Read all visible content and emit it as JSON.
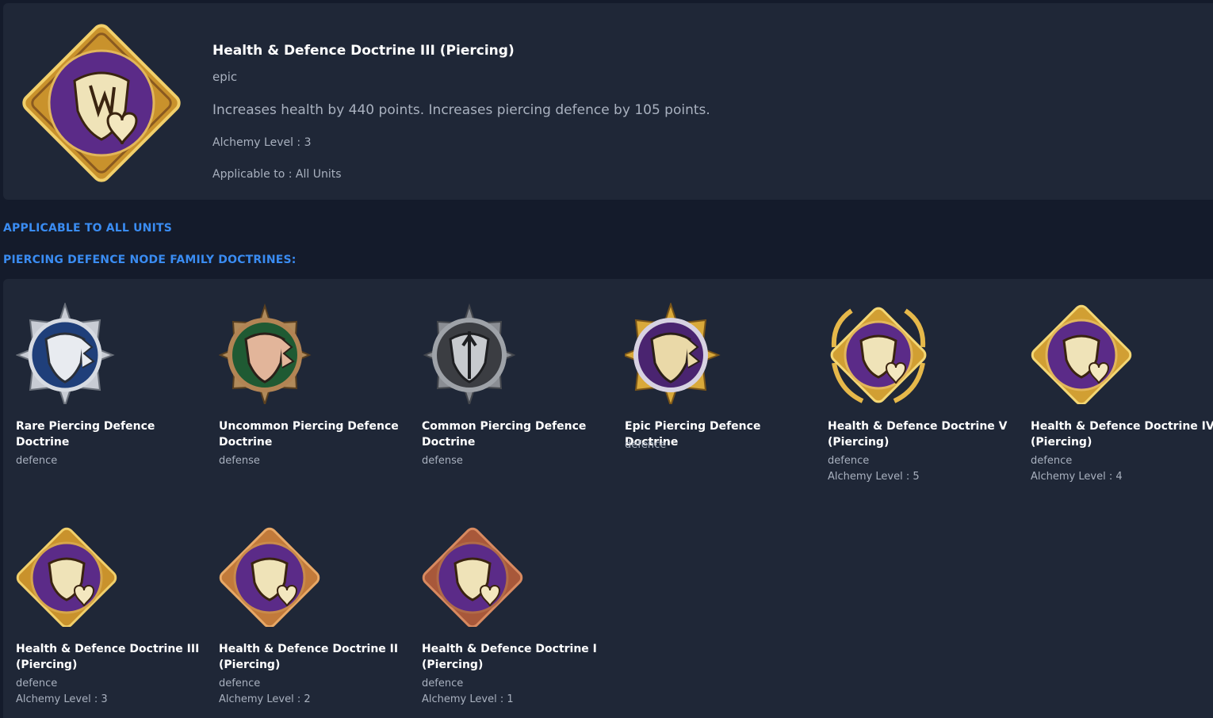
{
  "selected": {
    "title": "Health & Defence Doctrine III (Piercing)",
    "rarity": "epic",
    "description": "Increases health by 440 points. Increases piercing defence by 105 points.",
    "alchemy_level": "Alchemy Level : 3",
    "applicable": "Applicable to : All Units",
    "icon": "health-defence-doctrine-icon"
  },
  "headings": {
    "applicable_all": "APPLICABLE TO ALL UNITS",
    "family": "PIERCING DEFENCE NODE FAMILY DOCTRINES:"
  },
  "doctrines": [
    {
      "name": "Rare Piercing Defence Doctrine",
      "category": "defence",
      "alchemy": "",
      "icon": "rare-shield-icon"
    },
    {
      "name": "Uncommon Piercing Defence Doctrine",
      "category": "defense",
      "alchemy": "",
      "icon": "uncommon-shield-icon"
    },
    {
      "name": "Common Piercing Defence Doctrine",
      "category": "defense",
      "alchemy": "",
      "icon": "common-shield-icon"
    },
    {
      "name": "Epic Piercing Defence Doctrine",
      "category": "defence",
      "alchemy": "",
      "icon": "epic-shield-icon"
    },
    {
      "name": "Health & Defence Doctrine V (Piercing)",
      "category": "defence",
      "alchemy": "Alchemy Level : 5",
      "icon": "health-defence-v-icon"
    },
    {
      "name": "Health & Defence Doctrine IV (Piercing)",
      "category": "defence",
      "alchemy": "Alchemy Level : 4",
      "icon": "health-defence-iv-icon"
    },
    {
      "name": "Health & Defence Doctrine III (Piercing)",
      "category": "defence",
      "alchemy": "Alchemy Level : 3",
      "icon": "health-defence-iii-icon"
    },
    {
      "name": "Health & Defence Doctrine II (Piercing)",
      "category": "defence",
      "alchemy": "Alchemy Level : 2",
      "icon": "health-defence-ii-icon"
    },
    {
      "name": "Health & Defence Doctrine I (Piercing)",
      "category": "defence",
      "alchemy": "Alchemy Level : 1",
      "icon": "health-defence-i-icon"
    }
  ],
  "colors": {
    "accent": "#3a8cf2",
    "panel": "#1f2737",
    "background": "#141b2b",
    "purple": "#5a2a86",
    "gold": "#d9a93a"
  }
}
